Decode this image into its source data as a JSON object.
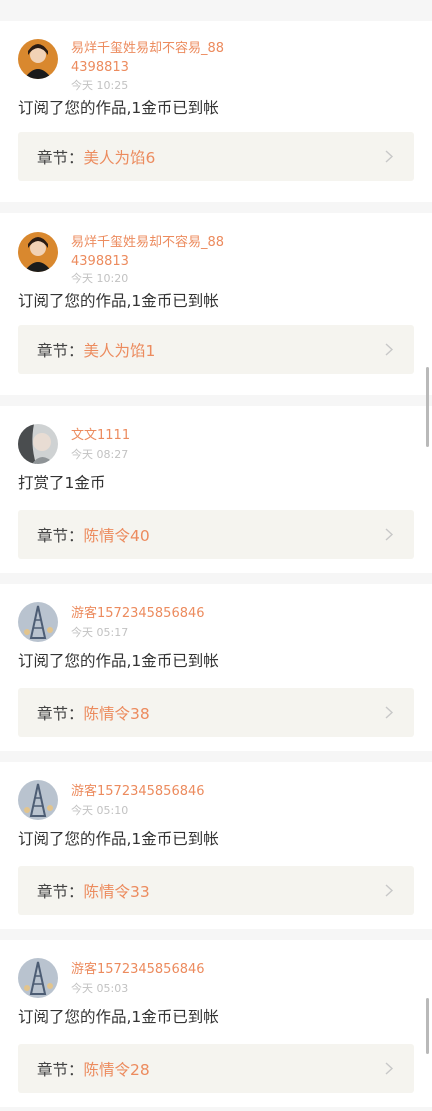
{
  "items": [
    {
      "user": "易烊千玺姓易却不容易_884398813",
      "time": "今天 10:25",
      "message": "订阅了您的作品,1金币已到帐",
      "chapter_label": "章节：",
      "chapter_title": "美人为馅6",
      "avatar": "portrait-dark-hair"
    },
    {
      "user": "易烊千玺姓易却不容易_884398813",
      "time": "今天 10:20",
      "message": "订阅了您的作品,1金币已到帐",
      "chapter_label": "章节：",
      "chapter_title": "美人为馅1",
      "avatar": "portrait-dark-hair"
    },
    {
      "user": "文文1111",
      "time": "今天 08:27",
      "message": "打赏了1金币",
      "chapter_label": "章节：",
      "chapter_title": "陈情令40",
      "avatar": "portrait-side-profile"
    },
    {
      "user": "游客1572345856846",
      "time": "今天 05:17",
      "message": "订阅了您的作品,1金币已到帐",
      "chapter_label": "章节：",
      "chapter_title": "陈情令38",
      "avatar": "eiffel-tower"
    },
    {
      "user": "游客1572345856846",
      "time": "今天 05:10",
      "message": "订阅了您的作品,1金币已到帐",
      "chapter_label": "章节：",
      "chapter_title": "陈情令33",
      "avatar": "eiffel-tower"
    },
    {
      "user": "游客1572345856846",
      "time": "今天 05:03",
      "message": "订阅了您的作品,1金币已到帐",
      "chapter_label": "章节：",
      "chapter_title": "陈情令28",
      "avatar": "eiffel-tower"
    }
  ],
  "colors": {
    "accent": "#ec8b5e",
    "chapter_bg": "#f5f4ef",
    "time": "#c2c2c2",
    "text": "#333333"
  }
}
